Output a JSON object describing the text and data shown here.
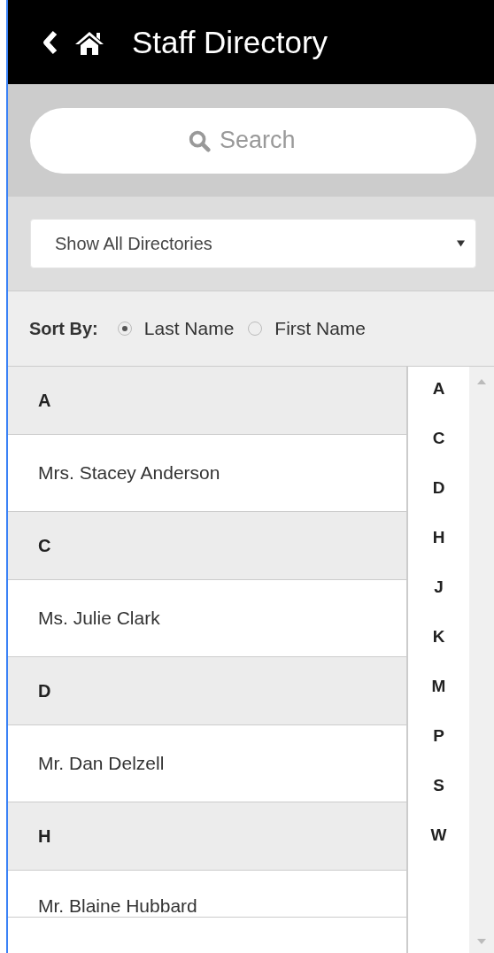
{
  "header": {
    "title": "Staff Directory"
  },
  "search": {
    "placeholder": "Search"
  },
  "directory_select": {
    "value": "Show All Directories"
  },
  "sort": {
    "label": "Sort By:",
    "options": [
      {
        "label": "Last Name",
        "selected": true
      },
      {
        "label": "First Name",
        "selected": false
      }
    ]
  },
  "sections": [
    {
      "letter": "A",
      "people": [
        "Mrs. Stacey Anderson"
      ]
    },
    {
      "letter": "C",
      "people": [
        "Ms. Julie Clark"
      ]
    },
    {
      "letter": "D",
      "people": [
        "Mr. Dan Delzell"
      ]
    },
    {
      "letter": "H",
      "people": [
        "Mr. Blaine Hubbard"
      ]
    }
  ],
  "alphabet_index": [
    "A",
    "C",
    "D",
    "H",
    "J",
    "K",
    "M",
    "P",
    "S",
    "W"
  ]
}
